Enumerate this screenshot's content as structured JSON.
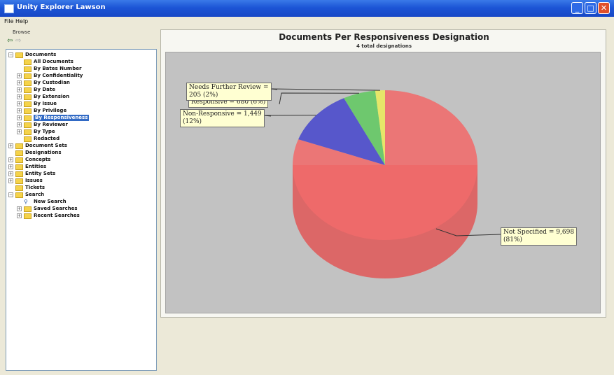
{
  "window": {
    "title": "Unity Explorer Lawson",
    "min_label": "_",
    "max_label": "□",
    "close_label": "✕"
  },
  "menu": [
    "File",
    "Help"
  ],
  "sidebar": {
    "header": "Browse",
    "tree": [
      {
        "label": "Documents",
        "level": 0,
        "expander": "−"
      },
      {
        "label": "All Documents",
        "level": 1,
        "expander": ""
      },
      {
        "label": "By Bates Number",
        "level": 1,
        "expander": ""
      },
      {
        "label": "By Confidentiality",
        "level": 1,
        "expander": "+"
      },
      {
        "label": "By Custodian",
        "level": 1,
        "expander": "+"
      },
      {
        "label": "By Date",
        "level": 1,
        "expander": "+"
      },
      {
        "label": "By Extension",
        "level": 1,
        "expander": "+"
      },
      {
        "label": "By Issue",
        "level": 1,
        "expander": "+"
      },
      {
        "label": "By Privilege",
        "level": 1,
        "expander": "+"
      },
      {
        "label": "By Responsiveness",
        "level": 1,
        "expander": "+",
        "selected": true
      },
      {
        "label": "By Reviewer",
        "level": 1,
        "expander": "+"
      },
      {
        "label": "By Type",
        "level": 1,
        "expander": "+"
      },
      {
        "label": "Redacted",
        "level": 1,
        "expander": ""
      },
      {
        "label": "Document Sets",
        "level": 0,
        "expander": "+"
      },
      {
        "label": "Designations",
        "level": 0,
        "expander": ""
      },
      {
        "label": "Concepts",
        "level": 0,
        "expander": "+"
      },
      {
        "label": "Entities",
        "level": 0,
        "expander": "+"
      },
      {
        "label": "Entity Sets",
        "level": 0,
        "expander": "+"
      },
      {
        "label": "Issues",
        "level": 0,
        "expander": "+"
      },
      {
        "label": "Tickets",
        "level": 0,
        "expander": ""
      },
      {
        "label": "Search",
        "level": 0,
        "expander": "−"
      },
      {
        "label": "New Search",
        "level": 1,
        "expander": "",
        "icon": "search"
      },
      {
        "label": "Saved Searches",
        "level": 1,
        "expander": "+"
      },
      {
        "label": "Recent Searches",
        "level": 1,
        "expander": "+"
      }
    ]
  },
  "chart_data": {
    "type": "pie",
    "title": "Documents Per Responsiveness Designation",
    "subtitle": "4 total designations",
    "style": "3d",
    "slices": [
      {
        "name": "Not Specified",
        "value": 9698,
        "percent": 81,
        "color": "#f06b6b",
        "label": "Not Specified = 9,698\n(81%)"
      },
      {
        "name": "Non-Responsive",
        "value": 1449,
        "percent": 12,
        "color": "#4848cc",
        "label": "Non-Responsive = 1,449\n(12%)"
      },
      {
        "name": "Responsive",
        "value": 680,
        "percent": 6,
        "color": "#62c862",
        "label": "Responsive = 680 (6%)"
      },
      {
        "name": "Needs Further Review",
        "value": 205,
        "percent": 2,
        "color": "#eaea5c",
        "label": "Needs Further Review =\n205 (2%)"
      }
    ]
  }
}
